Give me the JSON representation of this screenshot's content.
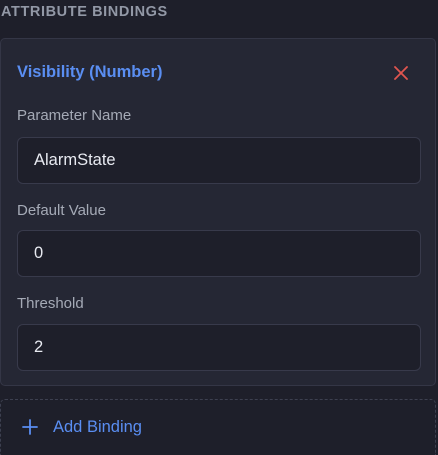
{
  "section": {
    "title": "ATTRIBUTE BINDINGS"
  },
  "binding": {
    "title": "Visibility (Number)",
    "remove_icon": "close-icon",
    "fields": {
      "parameter_name": {
        "label": "Parameter Name",
        "value": "AlarmState"
      },
      "default_value": {
        "label": "Default Value",
        "value": "0"
      },
      "threshold": {
        "label": "Threshold",
        "value": "2"
      }
    }
  },
  "add_binding": {
    "label": "Add Binding",
    "icon": "plus-icon"
  },
  "colors": {
    "background": "#1e1f2a",
    "card": "#252734",
    "accent": "#5a8ef2",
    "danger": "#e0554f",
    "label": "#a5aab6"
  }
}
